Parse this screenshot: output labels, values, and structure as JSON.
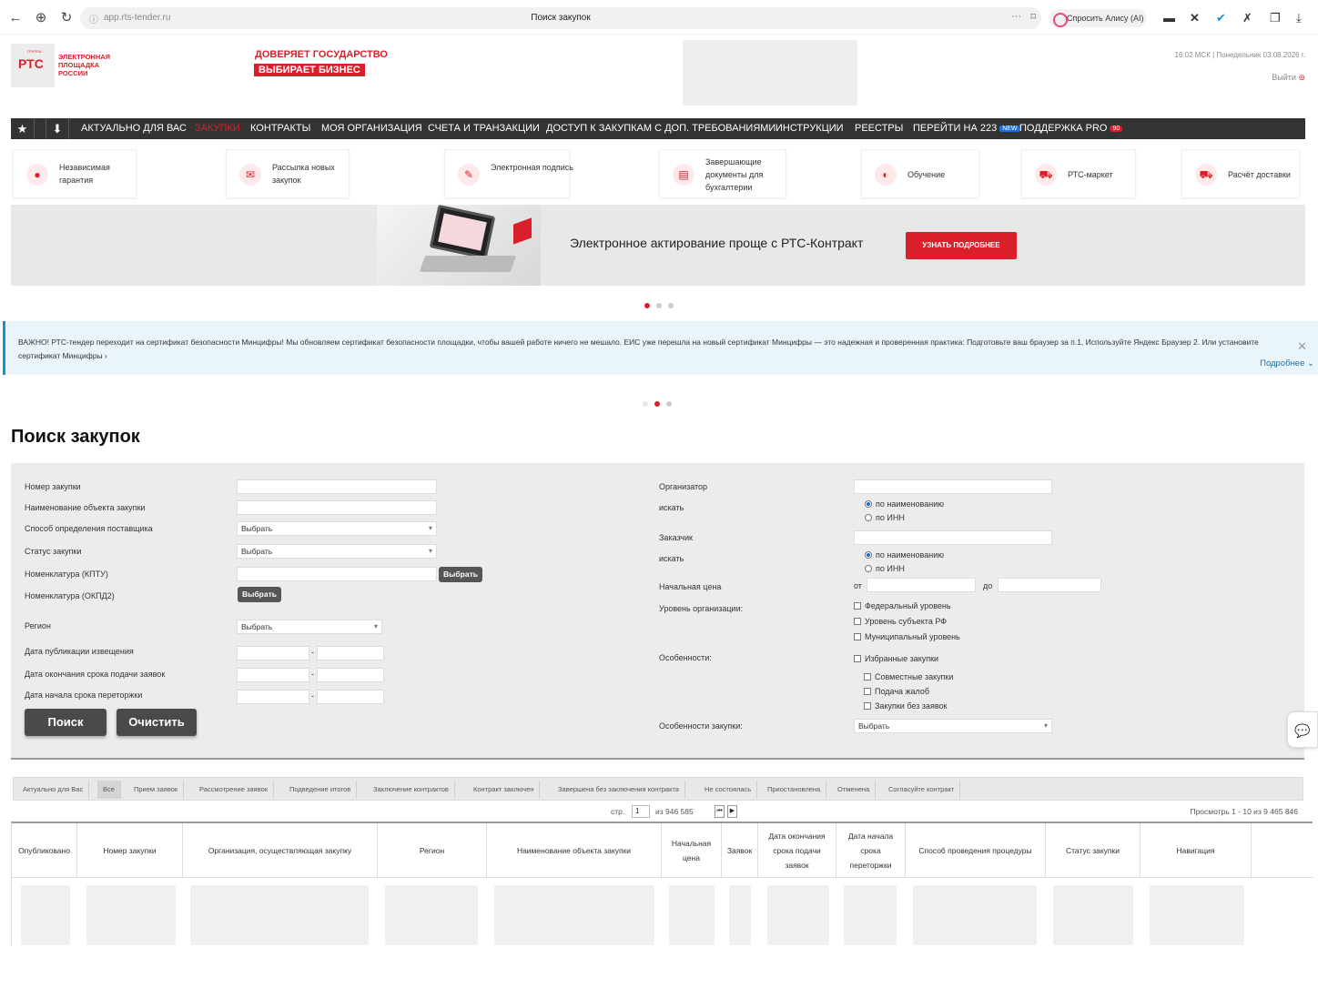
{
  "browser": {
    "url": "app.rts-tender.ru",
    "title": "Поиск закупок",
    "alice": "Спросить Алису (AI)"
  },
  "header": {
    "slogan1": "ДОВЕРЯЕТ ГОСУДАРСТВО",
    "slogan2": "ВЫБИРАЕТ БИЗНЕС",
    "logo_short": "РТС",
    "logo_tiny": "ГРУППА",
    "logo_text": "ЭЛЕКТРОННАЯ ПЛОЩАДКА РОССИИ",
    "datetime": "16:02 МСК | Понедельник 03.08.2026 г.",
    "logout": "Выйти"
  },
  "menu": {
    "items": [
      "Актуально для вас",
      "Закупки",
      "Контракты",
      "Моя организация",
      "Счета и транзакции",
      "Доступ к закупкам с доп. требованиями",
      "Инструкции",
      "Реестры",
      "Перейти на 223",
      "Поддержка PRO"
    ],
    "new_badge": "NEW",
    "pro_badge": "90"
  },
  "services": [
    {
      "label": "Независимая гарантия"
    },
    {
      "label": "Рассылка новых закупок"
    },
    {
      "label": "Электронная подпись"
    },
    {
      "label": "Завершающие документы для бухгалтерии"
    },
    {
      "label": "Обучение"
    },
    {
      "label": "РТС-маркет"
    },
    {
      "label": "Расчёт доставки"
    }
  ],
  "banner": {
    "text": "Электронное актирование проще с РТС-Контракт",
    "button": "УЗНАТЬ ПОДРОБНЕЕ"
  },
  "notice": {
    "text": "ВАЖНО! РТС-тендер переходит на сертификат безопасности Минцифры! Мы обновляем сертификат безопасности площадки, чтобы вашей работе ничего не мешало. ЕИС уже перешла на новый сертификат Минцифры — это надежная и проверенная практика: Подготовьте ваш браузер за п.1, Используйте Яндекс Браузер 2. Или установите сертификат Минцифры ›",
    "more": "Подробнее"
  },
  "page_title": "Поиск закупок",
  "form": {
    "left_labels": [
      "Номер закупки",
      "Наименование объекта закупки",
      "Способ определения поставщика",
      "Статус закупки",
      "Номенклатура (КПТУ)",
      "Номенклатура (ОКПД2)",
      "Регион",
      "Дата публикации извещения",
      "Дата окончания срока подачи заявок",
      "Дата начала срока переторжки"
    ],
    "select_placeholder": "Выбрать",
    "choose_btn": "Выбрать",
    "date_sep": "-",
    "search_btn": "Поиск",
    "clear_btn": "Очистить",
    "organizer": "Организатор",
    "search_by": "искать",
    "by_name": "по наименованию",
    "by_inn": "по ИНН",
    "customer": "Заказчик",
    "start_price": "Начальная цена",
    "from": "от",
    "to": "до",
    "org_level": "Уровень организации:",
    "levels": [
      "Федеральный уровень",
      "Уровень субъекта РФ",
      "Муниципальный уровень"
    ],
    "features": "Особенности:",
    "feature_items": [
      "Избранные закупки",
      "Совместные закупки",
      "Подача жалоб",
      "Закупки без заявок"
    ],
    "purchase_features": "Особенности закупки:"
  },
  "tabs": [
    "Актуально для Вас",
    "Все",
    "Прием заявок",
    "Рассмотрение заявок",
    "Подведение итогов",
    "Заключение контрактов",
    "Контракт заключен",
    "Завершена без заключения контракта",
    "Не состоялась",
    "Приостановлена",
    "Отменена",
    "Согласуйте контракт"
  ],
  "pager": {
    "page_label": "стр.",
    "page": "1",
    "of": "из 946 585",
    "views": "Просмотрь 1 - 10 из 9 465 846"
  },
  "table": {
    "headers": [
      "Опубликовано",
      "Номер закупки",
      "Организация, осуществляющая закупку",
      "Регион",
      "Наименование объекта закупки",
      "Начальная цена",
      "Заявок",
      "Дата окончания срока подачи заявок",
      "Дата начала срока переторжки",
      "Способ проведения процедуры",
      "Статус закупки",
      "Навигация"
    ]
  }
}
